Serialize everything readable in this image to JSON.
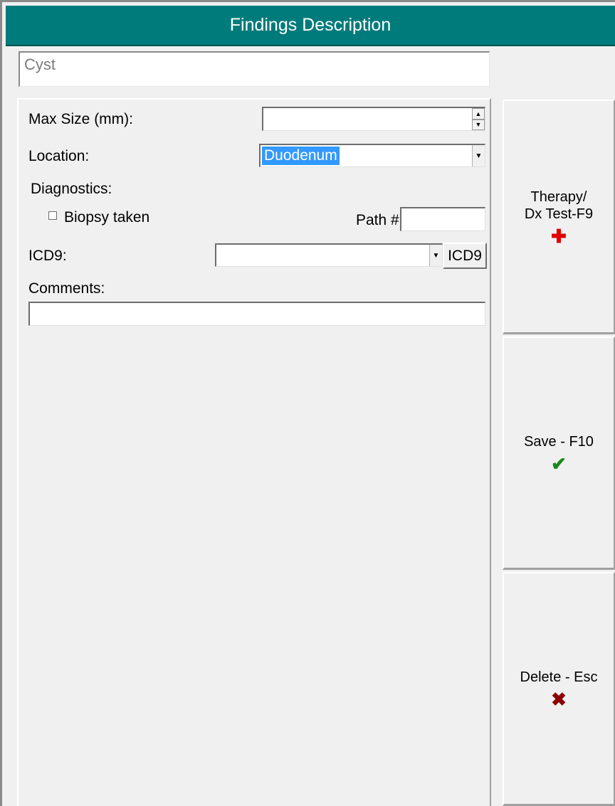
{
  "window": {
    "title": "Findings Description"
  },
  "finding": {
    "name": "Cyst"
  },
  "form": {
    "max_size_label": "Max Size (mm):",
    "max_size_value": "",
    "location_label": "Location:",
    "location_value": "Duodenum",
    "diagnostics_label": "Diagnostics:",
    "biopsy_label": "Biopsy taken",
    "biopsy_checked": false,
    "path_label": "Path #:",
    "path_value": "",
    "icd9_label": "ICD9:",
    "icd9_value": "",
    "icd9_button": "ICD9",
    "comments_label": "Comments:",
    "comments_value": ""
  },
  "actions": {
    "therapy_line1": "Therapy/",
    "therapy_line2": "Dx Test-F9",
    "therapy_icon": "red-cross-icon",
    "save_label": "Save - F10",
    "save_icon": "green-checkmark-icon",
    "delete_label": "Delete - Esc",
    "delete_icon": "red-x-icon"
  },
  "colors": {
    "title_bar": "#007b7b",
    "selection": "#3399ff",
    "cross": "#e00000",
    "check": "#1a8a1a",
    "x": "#8b0000"
  }
}
